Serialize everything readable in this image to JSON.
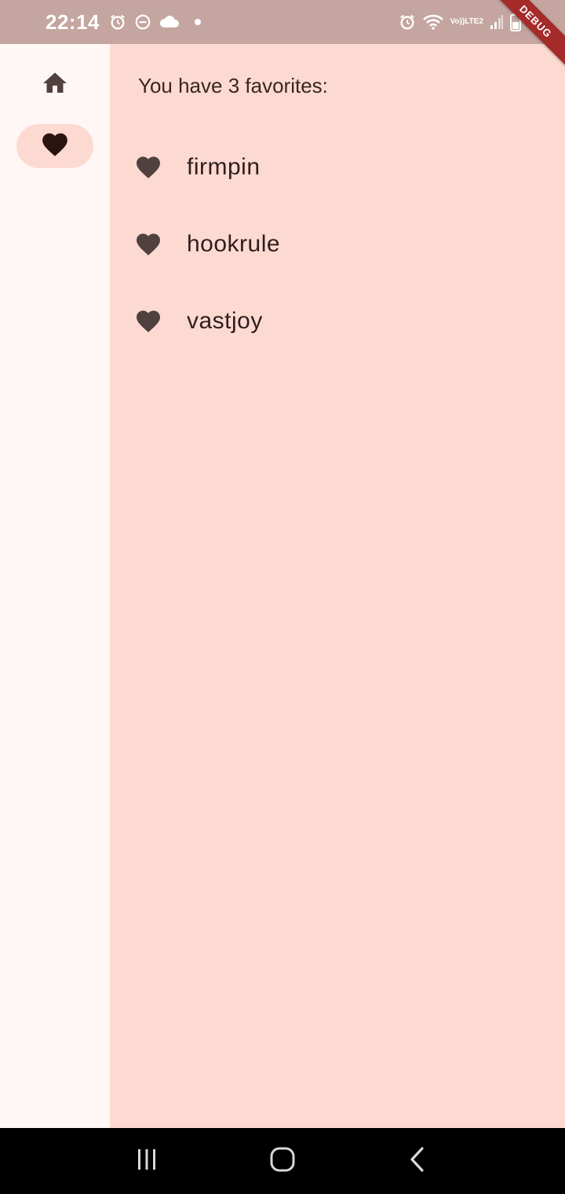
{
  "status_bar": {
    "time": "22:14",
    "left_icons": [
      "alarm-icon",
      "do-not-disturb-icon",
      "cloud-icon",
      "dot-icon"
    ],
    "right_icons": [
      "alarm-icon",
      "wifi-icon",
      "volte-icon",
      "signal-icon",
      "battery-icon"
    ],
    "volte_label": "Vo))",
    "lte_label": "LTE2"
  },
  "debug_banner": {
    "label": "DEBUG"
  },
  "nav_rail": {
    "items": [
      {
        "icon": "home-icon",
        "selected": false
      },
      {
        "icon": "favorite-icon",
        "selected": true
      }
    ]
  },
  "favorites": {
    "header": "You have 3 favorites:",
    "items": [
      {
        "name": "firmpin",
        "icon": "heart-icon"
      },
      {
        "name": "hookrule",
        "icon": "heart-icon"
      },
      {
        "name": "vastjoy",
        "icon": "heart-icon"
      }
    ]
  },
  "system_nav": {
    "buttons": [
      "recent-apps-icon",
      "home-circle-icon",
      "back-icon"
    ]
  },
  "colors": {
    "status_bar_bg": "#c4a59f",
    "rail_bg": "#fff7f5",
    "content_bg": "#fddad1",
    "selected_indicator": "#fddad1",
    "icon_color": "#504040",
    "text_color": "#2f1e1b",
    "debug_ribbon": "#a52a2a"
  }
}
